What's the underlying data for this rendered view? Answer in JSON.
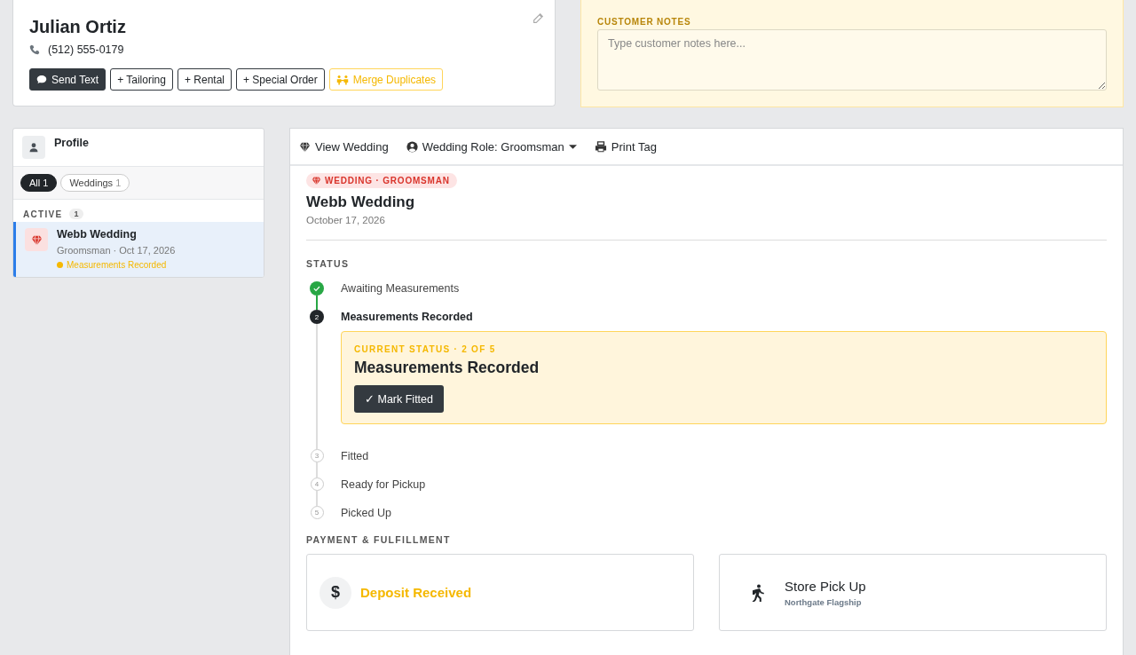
{
  "customer": {
    "name": "Julian Ortiz",
    "phone": "(512) 555-0179",
    "actions": [
      {
        "label": "Send Text",
        "kind": "primary"
      },
      {
        "label": "+ Tailoring",
        "kind": "outline"
      },
      {
        "label": "+ Rental",
        "kind": "outline"
      },
      {
        "label": "+ Special Order",
        "kind": "outline"
      },
      {
        "label": "Merge Duplicates",
        "kind": "warning"
      }
    ]
  },
  "customer_notes": {
    "label": "CUSTOMER NOTES",
    "placeholder": "Type customer notes here..."
  },
  "sidebar": {
    "title": "Profile",
    "filters": [
      {
        "label": "All",
        "count": "1",
        "selected": true
      },
      {
        "label": "Weddings",
        "count": "1",
        "selected": false
      }
    ],
    "section": {
      "label": "ACTIVE",
      "count": "1"
    },
    "items": [
      {
        "title": "Webb Wedding",
        "subtitle": "Groomsman · Oct 17, 2026",
        "status": "Measurements Recorded",
        "color": "#f5b800",
        "selected": true
      }
    ]
  },
  "toolbar": [
    {
      "label": "View Wedding",
      "kind": "gem"
    },
    {
      "label": "Wedding Role: Groomsman",
      "kind": "role"
    },
    {
      "label": "Print Tag",
      "kind": "print"
    }
  ],
  "event": {
    "badge": "WEDDING · GROOMSMAN",
    "title": "Webb Wedding",
    "date": "October 17, 2026"
  },
  "status": {
    "heading": "STATUS",
    "steps": [
      {
        "label": "Awaiting Measurements",
        "completed": true,
        "current": false
      },
      {
        "number": "2",
        "label": "Measurements Recorded",
        "completed": false,
        "current": true
      },
      {
        "number": "3",
        "label": "Fitted",
        "completed": false,
        "current": false
      },
      {
        "number": "4",
        "label": "Ready for Pickup",
        "completed": false,
        "current": false
      },
      {
        "number": "5",
        "label": "Picked Up",
        "completed": false,
        "current": false
      }
    ],
    "current": {
      "caption": "CURRENT STATUS · 2 OF 5",
      "title": "Measurements Recorded",
      "action": "✓ Mark Fitted"
    }
  },
  "payment": {
    "heading": "PAYMENT & FULFILLMENT",
    "cards": [
      {
        "kind": "payment",
        "symbol": "$",
        "title": "Deposit Received"
      },
      {
        "kind": "pickup",
        "title": "Store Pick Up",
        "subtitle": "Northgate Flagship"
      }
    ]
  }
}
